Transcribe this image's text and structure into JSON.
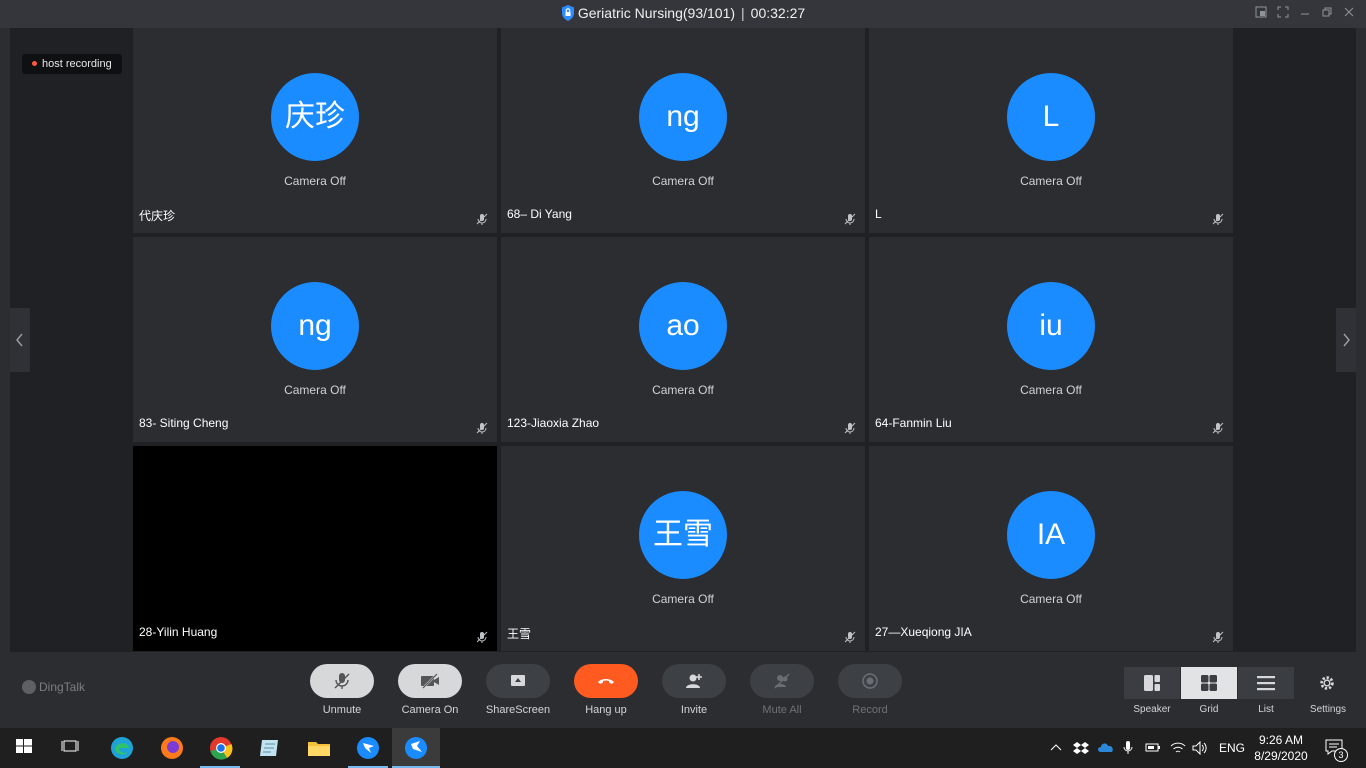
{
  "window": {
    "title": "Geriatric Nursing(93/101)",
    "timer": "00:32:27"
  },
  "recording": {
    "label": "host recording"
  },
  "participants": [
    {
      "name": "代庆珍",
      "initials": "庆珍",
      "status": "Camera Off"
    },
    {
      "name": "68– Di Yang",
      "initials": "ng",
      "status": "Camera Off"
    },
    {
      "name": "L",
      "initials": "L",
      "status": "Camera Off"
    },
    {
      "name": "83- Siting Cheng",
      "initials": "ng",
      "status": "Camera Off"
    },
    {
      "name": "123-Jiaoxia Zhao",
      "initials": "ao",
      "status": "Camera Off"
    },
    {
      "name": "64-Fanmin Liu",
      "initials": "iu",
      "status": "Camera Off"
    },
    {
      "name": "28-Yilin Huang",
      "initials": "",
      "status": ""
    },
    {
      "name": "王雪",
      "initials": "王雪",
      "status": "Camera Off"
    },
    {
      "name": "27—Xueqiong JIA",
      "initials": "IA",
      "status": "Camera Off"
    }
  ],
  "brand": "DingTalk",
  "controls": {
    "unmute": "Unmute",
    "camera_on": "Camera On",
    "share_screen": "ShareScreen",
    "hang_up": "Hang up",
    "invite": "Invite",
    "mute_all": "Mute All",
    "record": "Record"
  },
  "views": {
    "speaker": "Speaker",
    "grid": "Grid",
    "list": "List",
    "settings": "Settings"
  },
  "taskbar": {
    "language": "ENG",
    "time": "9:26 AM",
    "date": "8/29/2020",
    "notifications": "3"
  },
  "colors": {
    "avatar": "#1a8cff",
    "hangup": "#ff5a1f",
    "stage": "#1f2124",
    "tile": "#2b2d31"
  }
}
